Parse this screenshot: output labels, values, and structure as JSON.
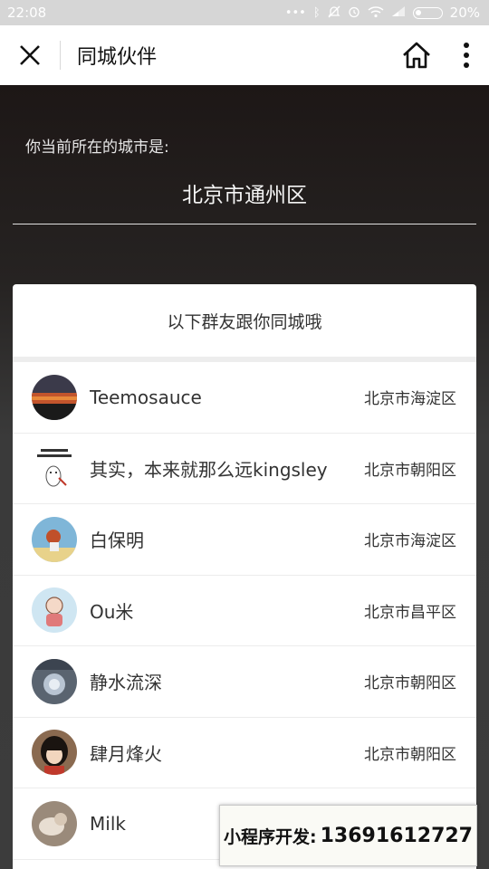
{
  "status_bar": {
    "time": "22:08",
    "battery": "20%"
  },
  "nav": {
    "title": "同城伙伴"
  },
  "hero": {
    "label": "你当前所在的城市是:",
    "city": "北京市通州区"
  },
  "card": {
    "header": "以下群友跟你同城哦",
    "users": [
      {
        "name": "Teemosauce",
        "location": "北京市海淀区"
      },
      {
        "name": "其实，本来就那么远kingsley",
        "location": "北京市朝阳区"
      },
      {
        "name": "白保明",
        "location": "北京市海淀区"
      },
      {
        "name": "Ou米",
        "location": "北京市昌平区"
      },
      {
        "name": "静水流深",
        "location": "北京市朝阳区"
      },
      {
        "name": "肆月烽火",
        "location": "北京市朝阳区"
      },
      {
        "name": "Milk",
        "location": ""
      }
    ]
  },
  "watermark": {
    "label": "小程序开发:",
    "phone": "13691612727"
  }
}
